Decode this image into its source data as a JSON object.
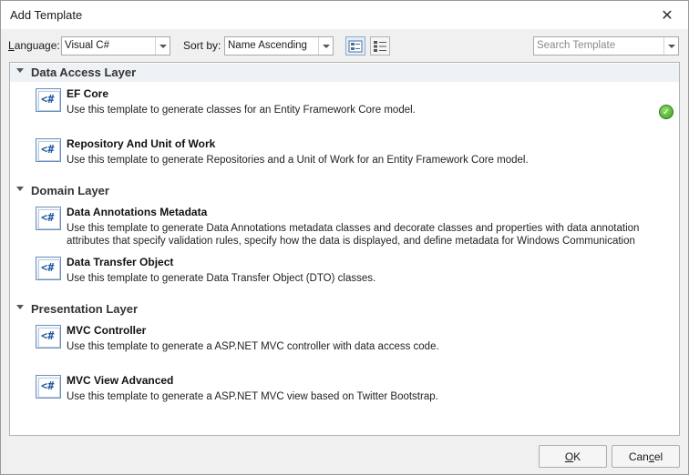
{
  "window": {
    "title": "Add Template",
    "close": "✕"
  },
  "toolbar": {
    "language_label_u": "L",
    "language_label_rest": "anguage:",
    "language_value": "Visual C#",
    "sort_label": "Sort by:",
    "sort_value": "Name Ascending",
    "search_placeholder": "Search Template"
  },
  "groups": [
    {
      "title": "Data Access Layer",
      "items": [
        {
          "name": "EF Core",
          "desc": "Use this template to generate classes for an Entity Framework Core model.",
          "icon": "<#"
        },
        {
          "name": "Repository And Unit of Work",
          "desc": "Use this template to generate Repositories and a Unit of Work for an Entity Framework Core model.",
          "icon": "<#"
        }
      ]
    },
    {
      "title": "Domain Layer",
      "items": [
        {
          "name": "Data Annotations Metadata",
          "desc": "Use this template to generate Data Annotations metadata classes and decorate classes and properties with data annotation attributes that specify validation rules, specify how the data is displayed, and define metadata for Windows Communication",
          "icon": "<#"
        },
        {
          "name": "Data Transfer Object",
          "desc": "Use this template to generate Data Transfer Object (DTO) classes.",
          "icon": "<#"
        }
      ]
    },
    {
      "title": "Presentation Layer",
      "items": [
        {
          "name": "MVC Controller",
          "desc": "Use this template to generate a ASP.NET MVC controller with data access code.",
          "icon": "<#"
        },
        {
          "name": "MVC View Advanced",
          "desc": "Use this template to generate a ASP.NET MVC view based on Twitter Bootstrap.",
          "icon": "<#"
        }
      ]
    }
  ],
  "footer": {
    "ok_u": "O",
    "ok_rest": "K",
    "cancel_pre": "Can",
    "cancel_u": "c",
    "cancel_rest": "el"
  }
}
